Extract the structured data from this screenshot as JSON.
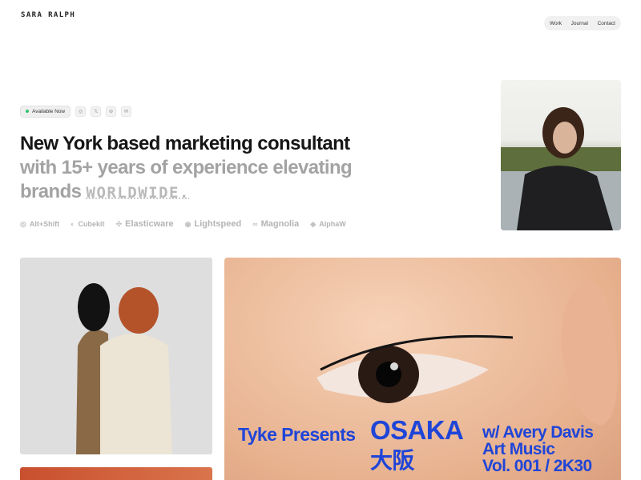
{
  "header": {
    "logo": "SARA RALPH",
    "nav": [
      "Work",
      "Journal",
      "Contact"
    ]
  },
  "hero": {
    "badge": "Available Now",
    "social_icons": [
      "instagram-icon",
      "x-icon",
      "dribbble-icon",
      "mail-icon"
    ],
    "headline_line1": "New York based marketing consultant",
    "headline_line2": "with 15+ years of experience elevating",
    "headline_line3_prefix": "brands",
    "headline_line3_pixel": "WORLDWIDE.",
    "client_logos": [
      "Alt+Shift",
      "Cubekit",
      "Elasticware",
      "Lightspeed",
      "Magnolia",
      "AlphaW"
    ]
  },
  "poster": {
    "left": "Tyke Presents",
    "title": "OSAKA",
    "title_jp": "大阪",
    "right_line1": "w/ Avery Davis",
    "right_line2": "Art Music",
    "right_line3": "Vol. 001 / 2K30"
  },
  "colors": {
    "accent_blue": "#1f45d8",
    "status_green": "#2cc46b",
    "muted_text": "#a3a3a3"
  }
}
